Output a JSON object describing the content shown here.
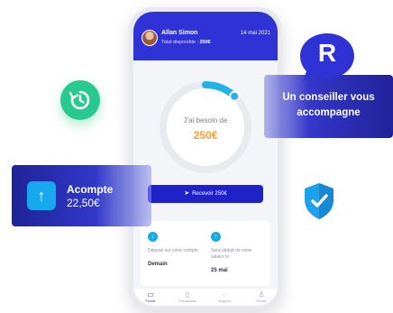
{
  "header": {
    "user_name": "Allan Simon",
    "date": "14 mai 2021",
    "balance_label": "Total disponible : ",
    "balance_value": "250€"
  },
  "gauge": {
    "label": "J'ai besoin de",
    "amount": "250€",
    "fill_fraction": 0.12,
    "colors": {
      "track": "#e9eaf0",
      "arc": "#1fb3ea",
      "amount": "#ff9a2e"
    }
  },
  "receive_button": {
    "label": "Recevoir 250€",
    "icon": "paper-plane-icon"
  },
  "info": {
    "left": {
      "icon": "arrow-down-icon",
      "text": "Déposé sur votre compte",
      "value": "Demain"
    },
    "right": {
      "icon": "arrow-up-icon",
      "text": "Sera déduit de votre salaire le :",
      "value": "25 mai"
    }
  },
  "tabs": [
    {
      "label": "Frichti",
      "icon": "wallet-icon",
      "active": true
    },
    {
      "label": "Transaction",
      "icon": "receipt-icon",
      "active": false
    },
    {
      "label": "Support",
      "icon": "chat-icon",
      "active": false
    },
    {
      "label": "Profile",
      "icon": "user-icon",
      "active": false
    }
  ],
  "acompte": {
    "title": "Acompte",
    "amount": "22,50€",
    "icon": "arrow-up-icon"
  },
  "advisor": {
    "logo_letter": "R",
    "line1": "Un conseiller vous",
    "line2": "accompagne"
  },
  "badges": {
    "refresh": "refresh-icon",
    "shield": "shield-check-icon"
  },
  "colors": {
    "brand_blue": "#2f33d6",
    "green": "#27c98f",
    "light_blue": "#1ba7e0"
  }
}
